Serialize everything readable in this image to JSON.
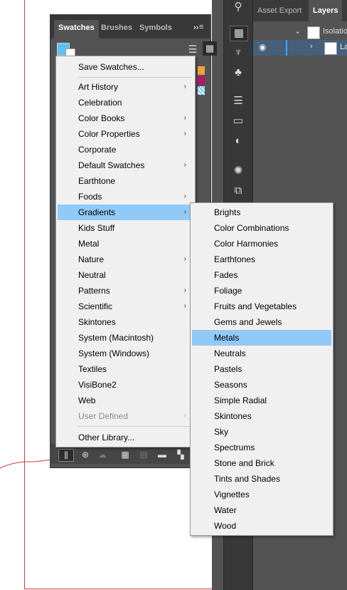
{
  "layers_panel": {
    "tabs": [
      "Asset Export",
      "Layers"
    ],
    "rows": [
      "Isolatio",
      "La"
    ]
  },
  "swatches_panel": {
    "tabs": [
      "Swatches",
      "Brushes",
      "Symbols"
    ],
    "overflow_glyph": "››"
  },
  "library_menu": {
    "save_item": "Save Swatches...",
    "items": [
      {
        "label": "Art History",
        "submenu": true
      },
      {
        "label": "Celebration",
        "submenu": false
      },
      {
        "label": "Color Books",
        "submenu": true
      },
      {
        "label": "Color Properties",
        "submenu": true
      },
      {
        "label": "Corporate",
        "submenu": false
      },
      {
        "label": "Default Swatches",
        "submenu": true
      },
      {
        "label": "Earthtone",
        "submenu": false
      },
      {
        "label": "Foods",
        "submenu": true
      },
      {
        "label": "Gradients",
        "submenu": true,
        "highlighted": true
      },
      {
        "label": "Kids Stuff",
        "submenu": false
      },
      {
        "label": "Metal",
        "submenu": false
      },
      {
        "label": "Nature",
        "submenu": true
      },
      {
        "label": "Neutral",
        "submenu": false
      },
      {
        "label": "Patterns",
        "submenu": true
      },
      {
        "label": "Scientific",
        "submenu": true
      },
      {
        "label": "Skintones",
        "submenu": false
      },
      {
        "label": "System (Macintosh)",
        "submenu": false
      },
      {
        "label": "System (Windows)",
        "submenu": false
      },
      {
        "label": "Textiles",
        "submenu": false
      },
      {
        "label": "VisiBone2",
        "submenu": false
      },
      {
        "label": "Web",
        "submenu": false
      },
      {
        "label": "User Defined",
        "submenu": true,
        "disabled": true
      }
    ],
    "other_item": "Other Library..."
  },
  "gradients_submenu": {
    "items": [
      {
        "label": "Brights"
      },
      {
        "label": "Color Combinations"
      },
      {
        "label": "Color Harmonies"
      },
      {
        "label": "Earthtones"
      },
      {
        "label": "Fades"
      },
      {
        "label": "Foliage"
      },
      {
        "label": "Fruits and Vegetables"
      },
      {
        "label": "Gems and Jewels"
      },
      {
        "label": "Metals",
        "highlighted": true
      },
      {
        "label": "Neutrals"
      },
      {
        "label": "Pastels"
      },
      {
        "label": "Seasons"
      },
      {
        "label": "Simple Radial"
      },
      {
        "label": "Skintones"
      },
      {
        "label": "Sky"
      },
      {
        "label": "Spectrums"
      },
      {
        "label": "Stone and Brick"
      },
      {
        "label": "Tints and Shades"
      },
      {
        "label": "Vignettes"
      },
      {
        "label": "Water"
      },
      {
        "label": "Wood"
      }
    ]
  },
  "colors": {
    "highlight": "#91c9f7",
    "fill_swatch": "#5bc3f5",
    "swatch_orange": "#f2a33a",
    "swatch_magenta": "#b3176c"
  }
}
